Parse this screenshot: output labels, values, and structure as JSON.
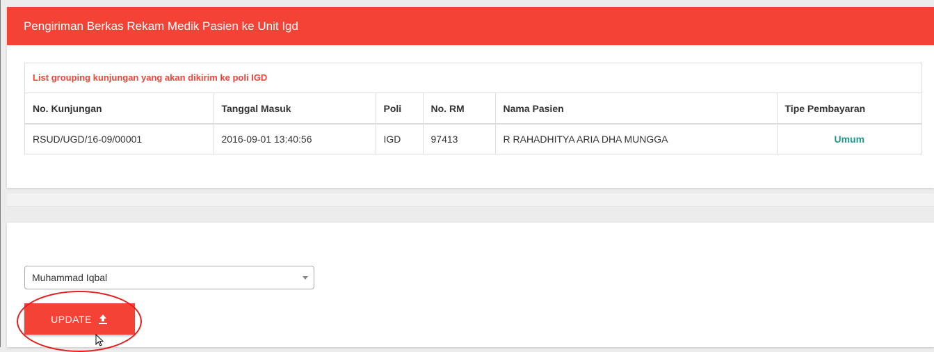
{
  "header": {
    "title": "Pengiriman Berkas Rekam Medik Pasien ke Unit Igd"
  },
  "table": {
    "caption": "List grouping kunjungan yang akan dikirim ke poli IGD",
    "columns": [
      "No. Kunjungan",
      "Tanggal Masuk",
      "Poli",
      "No. RM",
      "Nama Pasien",
      "Tipe Pembayaran"
    ],
    "rows": [
      [
        "RSUD/UGD/16-09/00001",
        "2016-09-01 13:40:56",
        "IGD",
        "97413",
        "R RAHADHITYA ARIA DHA MUNGGA",
        "Umum"
      ]
    ]
  },
  "form": {
    "select_value": "Muhammad Iqbal",
    "update_label": "UPDATE"
  },
  "icons": {
    "upload": "upload-icon",
    "dropdown": "chevron-down-icon",
    "cursor": "cursor-icon"
  },
  "colors": {
    "accent": "#f44336",
    "payment": "#1a9a87",
    "highlight": "#e41c1c"
  }
}
